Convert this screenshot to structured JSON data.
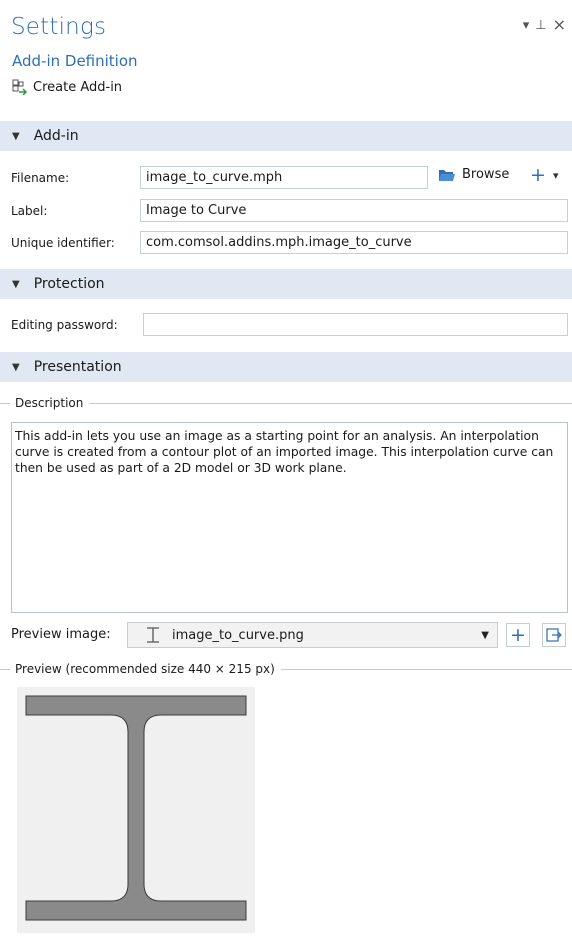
{
  "header": {
    "title": "Settings",
    "subtitle": "Add-in Definition",
    "create_label": "Create Add-in",
    "controls": {
      "dropdown": "▾",
      "pin": "⊥",
      "close": "×"
    }
  },
  "addin": {
    "section_label": "Add-in",
    "filename_label": "Filename:",
    "filename_value": "image_to_curve.mph",
    "browse_label": "Browse",
    "label_label": "Label:",
    "label_value": "Image to Curve",
    "uid_label": "Unique identifier:",
    "uid_value": "com.comsol.addins.mph.image_to_curve"
  },
  "protection": {
    "section_label": "Protection",
    "password_label": "Editing password:",
    "password_value": ""
  },
  "presentation": {
    "section_label": "Presentation",
    "description_group": "Description",
    "description_text": "This add-in lets you use an image as a starting point for an analysis. An interpolation curve is created from a contour plot of an imported image. This interpolation curve can then be used as part of a 2D model or 3D work plane.",
    "preview_image_label": "Preview image:",
    "preview_image_value": "image_to_curve.png",
    "preview_group": "Preview (recommended size 440 × 215 px)"
  },
  "colors": {
    "accent": "#2f6fb3",
    "section_bg": "#dfe8f3",
    "ibeam_fill": "#8a8a8a"
  }
}
